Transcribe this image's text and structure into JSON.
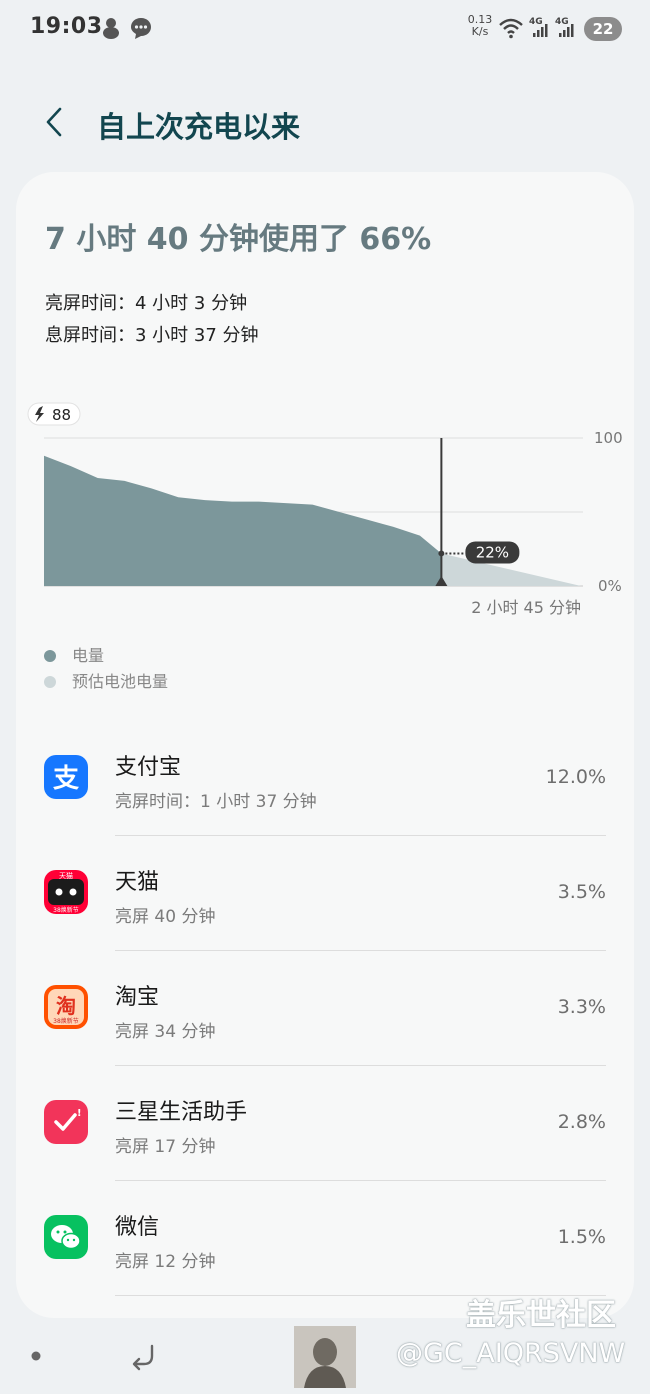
{
  "status": {
    "time": "19:03",
    "net_speed_value": "0.13",
    "net_speed_unit": "K/s",
    "signal1_label": "4G",
    "signal2_label": "4G",
    "battery_level": "22"
  },
  "header": {
    "title": "自上次充电以来"
  },
  "summary": {
    "headline": "7 小时 40 分钟使用了 66%",
    "screen_on": "亮屏时间：4 小时 3 分钟",
    "screen_off": "息屏时间：3 小时 37 分钟"
  },
  "chart_data": {
    "type": "area",
    "charge_start_label": "88",
    "y_max_label": "100",
    "y_min_label": "0%",
    "ylim": [
      0,
      100
    ],
    "current_value_label": "22%",
    "remaining_label": "2 小时 45 分钟",
    "series": [
      {
        "name": "电量",
        "color": "#7c979b",
        "x": [
          0,
          0.05,
          0.1,
          0.15,
          0.2,
          0.25,
          0.3,
          0.35,
          0.4,
          0.45,
          0.5,
          0.55,
          0.6,
          0.65,
          0.7,
          0.74
        ],
        "y": [
          88,
          81,
          73,
          71,
          66,
          60,
          58,
          57,
          57,
          56,
          55,
          50,
          45,
          40,
          34,
          22
        ]
      },
      {
        "name": "预估电池电量",
        "color": "#cdd7d9",
        "x": [
          0.74,
          1.0
        ],
        "y": [
          22,
          0
        ]
      }
    ],
    "legend": [
      "电量",
      "预估电池电量"
    ],
    "grid": true
  },
  "apps": [
    {
      "name": "支付宝",
      "sub": "亮屏时间：1 小时 37 分钟",
      "percent": "12.0%",
      "icon": "alipay-icon"
    },
    {
      "name": "天猫",
      "sub": "亮屏 40 分钟",
      "percent": "3.5%",
      "icon": "tmall-icon",
      "icon_text": "天猫",
      "icon_subtext": "38焕新节"
    },
    {
      "name": "淘宝",
      "sub": "亮屏 34 分钟",
      "percent": "3.3%",
      "icon": "taobao-icon",
      "icon_text": "淘",
      "icon_subtext": "38焕新节"
    },
    {
      "name": "三星生活助手",
      "sub": "亮屏 17 分钟",
      "percent": "2.8%",
      "icon": "samsung-life-assistant-icon"
    },
    {
      "name": "微信",
      "sub": "亮屏 12 分钟",
      "percent": "1.5%",
      "icon": "wechat-icon"
    }
  ],
  "watermark": {
    "site": "盖乐世社区",
    "user": "@GC_AIQRSVNW"
  }
}
